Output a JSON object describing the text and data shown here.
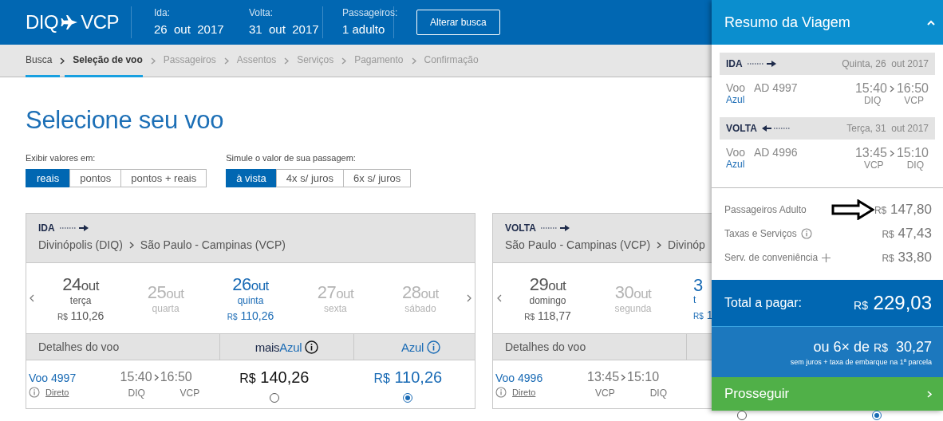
{
  "header": {
    "origin": "DIQ",
    "destination": "VCP",
    "fields": [
      {
        "label": "Ida:",
        "value": "26  out  2017"
      },
      {
        "label": "Volta:",
        "value": "31  out  2017"
      },
      {
        "label": "Passageiros:",
        "value": "1 adulto"
      }
    ],
    "button": "Alterar busca"
  },
  "breadcrumb": [
    {
      "label": "Busca",
      "completed": true,
      "selected": false
    },
    {
      "label": "Seleção de voo",
      "completed": false,
      "selected": true
    },
    {
      "label": "Passageiros",
      "completed": false,
      "selected": false
    },
    {
      "label": "Assentos",
      "completed": false,
      "selected": false
    },
    {
      "label": "Serviços",
      "completed": false,
      "selected": false
    },
    {
      "label": "Pagamento",
      "completed": false,
      "selected": false
    },
    {
      "label": "Confirmação",
      "completed": false,
      "selected": false
    }
  ],
  "title": "Selecione seu voo",
  "options": [
    {
      "label": "Exibir valores em:",
      "choices": [
        {
          "label": "reais",
          "selected": true
        },
        {
          "label": "pontos",
          "selected": false
        },
        {
          "label": "pontos + reais",
          "selected": false
        }
      ]
    },
    {
      "label": "Simule o valor de sua passagem:",
      "choices": [
        {
          "label": "à vista",
          "selected": true
        },
        {
          "label": "4x s/ juros",
          "selected": false
        },
        {
          "label": "6x s/ juros",
          "selected": false
        }
      ]
    }
  ],
  "flights": [
    {
      "direction": "IDA",
      "kind": "outbound",
      "from": "Divinópolis (DIQ)",
      "to": "São Paulo - Campinas (VCP)",
      "dates": [
        {
          "day": "24",
          "month": "out",
          "weekday": "terça",
          "currency": "R$",
          "price": "110,26",
          "available": true,
          "selected": false,
          "kind": "full"
        },
        {
          "day": "25",
          "month": "out",
          "weekday": "quarta",
          "available": false,
          "selected": false,
          "kind": "full"
        },
        {
          "day": "26",
          "month": "out",
          "weekday": "quinta",
          "currency": "R$",
          "price": "110,26",
          "available": true,
          "selected": true,
          "kind": "full"
        },
        {
          "day": "27",
          "month": "out",
          "weekday": "sexta",
          "available": false,
          "selected": false,
          "kind": "full"
        },
        {
          "day": "28",
          "month": "out",
          "weekday": "sábado",
          "available": false,
          "selected": false,
          "kind": "full"
        }
      ],
      "details_label": "Detalhes do voo",
      "fare_headers": [
        {
          "prefix": "mais",
          "name": "Azul"
        },
        {
          "name": "Azul"
        }
      ],
      "flight": {
        "number": "Voo 4997",
        "info": "Direto",
        "depart": "15:40",
        "arrive": "16:50",
        "from": "DIQ",
        "to": "VCP",
        "fares": [
          {
            "currency": "R$",
            "amount": "140,26",
            "selected": false
          },
          {
            "currency": "R$",
            "amount": "110,26",
            "selected": true
          }
        ]
      }
    },
    {
      "direction": "VOLTA",
      "kind": "outbound",
      "from": "São Paulo - Campinas (VCP)",
      "to": "Divinóp",
      "dates": [
        {
          "day": "29",
          "month": "out",
          "weekday": "domingo",
          "currency": "R$",
          "price": "118,77",
          "available": true,
          "selected": false,
          "kind": "full"
        },
        {
          "day": "30",
          "month": "out",
          "weekday": "segunda",
          "available": false,
          "selected": false,
          "kind": "full"
        },
        {
          "day": "3",
          "weekday": "t",
          "currency": "R$",
          "price": "1",
          "available": true,
          "selected": true,
          "kind": "cut"
        }
      ],
      "details_label": "Detalhes do voo",
      "flight": {
        "number": "Voo 4996",
        "info": "Direto",
        "depart": "13:45",
        "arrive": "15:10",
        "from": "VCP",
        "to": "DIQ",
        "fares": [
          {
            "selected": false
          },
          {
            "selected": true
          }
        ]
      }
    }
  ],
  "summary": {
    "title": "Resumo da Viagem",
    "legs": [
      {
        "direction": "IDA",
        "kind": "outbound",
        "date": "Quinta, 26  out 2017",
        "flight": "Voo   AD 4997",
        "airline": "Azul",
        "depart": "15:40",
        "arrive": "16:50",
        "from": "DIQ",
        "to": "VCP"
      },
      {
        "direction": "VOLTA",
        "kind": "return",
        "date": "Terça, 31  out 2017",
        "flight": "Voo   AD 4996",
        "airline": "Azul",
        "depart": "13:45",
        "arrive": "15:10",
        "from": "VCP",
        "to": "DIQ"
      }
    ],
    "charges": [
      {
        "label": "Passageiros Adulto",
        "kind": "plain",
        "currency": "R$",
        "amount": "147,80",
        "arrow": true
      },
      {
        "label": "Taxas e Serviços",
        "kind": "info",
        "currency": "R$",
        "amount": "47,43",
        "arrow": false
      },
      {
        "label": "Serv. de conveniência",
        "kind": "plus",
        "currency": "R$",
        "amount": "33,80",
        "arrow": false
      }
    ],
    "total": {
      "label": "Total a pagar:",
      "currency": "R$",
      "amount": "229,03"
    },
    "installment": {
      "prefix": "ou 6× de",
      "currency": "R$",
      "amount": "30,27",
      "note": "sem juros + taxa de embarque na 1ª parcela"
    },
    "proceed": "Prosseguir"
  }
}
